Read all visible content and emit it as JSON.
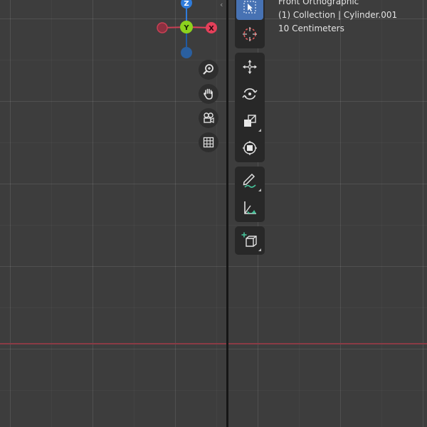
{
  "viewport_info": {
    "view_name": "Front Orthographic",
    "collection_line": "(1) Collection | Cylinder.001",
    "scale_line": "10 Centimeters"
  },
  "gizmo": {
    "axis_z_label": "Z",
    "axis_y_label": "Y",
    "axis_x_label": "X",
    "colors": {
      "x": "#e4405a",
      "y": "#8cd21e",
      "z": "#2f7cdb"
    }
  },
  "nav_icons": [
    "zoom-icon",
    "hand-pan-icon",
    "camera-toggle-icon",
    "grid-ortho-icon"
  ],
  "toolbar_icons": [
    "select-box-icon",
    "cursor-icon",
    "move-icon",
    "rotate-icon",
    "scale-icon",
    "transform-icon",
    "annotate-icon",
    "measure-icon",
    "add-cube-icon"
  ],
  "colors": {
    "accent": "#4772b3",
    "axis_line": "#8a3b45",
    "background": "#3d3d3d"
  }
}
